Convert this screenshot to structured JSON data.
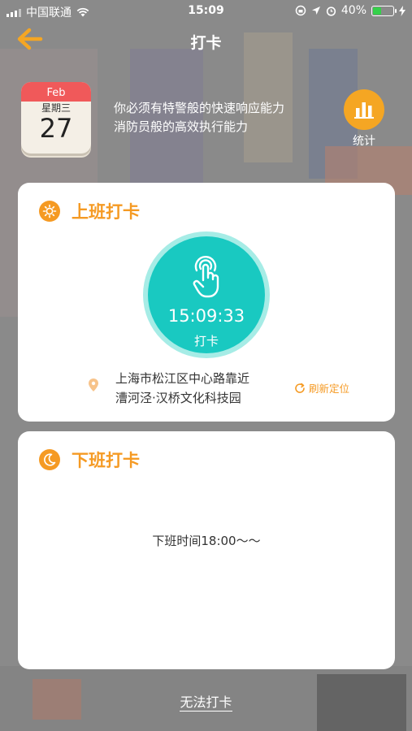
{
  "status_bar": {
    "carrier": "中国联通",
    "time": "15:09",
    "battery": "40%",
    "battery_level": 0.4
  },
  "nav": {
    "title": "打卡"
  },
  "calendar": {
    "month": "Feb",
    "weekday": "星期三",
    "day": "27"
  },
  "motto": {
    "line1": "你必须有特警般的快速响应能力",
    "line2": "消防员般的高效执行能力"
  },
  "stats": {
    "label": "统计"
  },
  "clock_in": {
    "title": "上班打卡",
    "time": "15:09:33",
    "button_label": "打卡",
    "location_line1": "上海市松江区中心路靠近",
    "location_line2": "漕河泾·汉桥文化科技园",
    "refresh_label": "刷新定位"
  },
  "clock_out": {
    "title": "下班打卡",
    "time_text": "下班时间18:00～～"
  },
  "footer": {
    "cannot_label": "无法打卡"
  },
  "colors": {
    "accent": "#f59a23",
    "teal": "#19c9c1",
    "calendar_red": "#f0595a"
  }
}
